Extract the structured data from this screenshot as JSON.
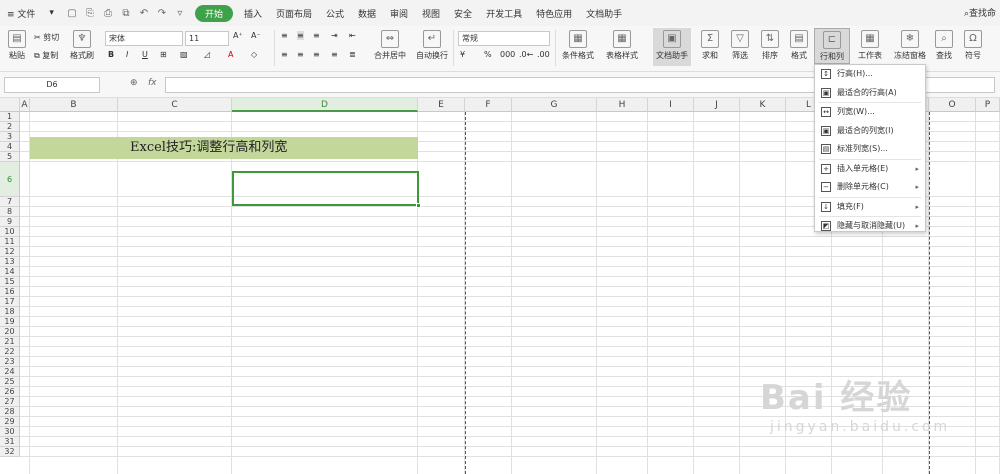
{
  "menubar": {
    "file": "≡ 文件",
    "tabs": [
      "开始",
      "插入",
      "页面布局",
      "公式",
      "数据",
      "审阅",
      "视图",
      "安全",
      "开发工具",
      "特色应用",
      "文档助手"
    ],
    "search": "查找命"
  },
  "ribbon": {
    "paste": "粘贴",
    "cut": "剪切",
    "copy": "复制",
    "format_painter": "格式刷",
    "font_name": "宋体",
    "font_size": "11",
    "merge": "合并居中",
    "wrap": "自动换行",
    "number_format": "常规",
    "cond_format": "条件格式",
    "table_style": "表格样式",
    "doc_helper": "文档助手",
    "sum": "求和",
    "filter": "筛选",
    "sort": "排序",
    "format": "格式",
    "row_col": "行和列",
    "worksheet": "工作表",
    "freeze": "冻结窗格",
    "find": "查找",
    "symbol": "符号"
  },
  "formula_bar": {
    "name_box": "D6",
    "fx": "fx",
    "content": ""
  },
  "sheet": {
    "columns": [
      "A",
      "B",
      "C",
      "D",
      "E",
      "F",
      "G",
      "H",
      "I",
      "J",
      "K",
      "L",
      "M",
      "N",
      "O",
      "P"
    ],
    "rows": [
      "1",
      "2",
      "3",
      "4",
      "5",
      "6",
      "7",
      "8",
      "9",
      "10",
      "11",
      "12",
      "13",
      "14",
      "15",
      "16",
      "17",
      "18",
      "19",
      "20",
      "21",
      "22",
      "23",
      "24",
      "25",
      "26",
      "27",
      "28",
      "29",
      "30",
      "31",
      "32"
    ],
    "title_cell": "Excel技巧:调整行高和列宽",
    "selected_cell": "D6",
    "title_fill": "#c4d79b",
    "accent": "#3fa14a"
  },
  "row_col_menu": {
    "items": [
      {
        "label": "行高(H)...",
        "icon": "row-height-icon",
        "submenu": false
      },
      {
        "label": "最适合的行高(A)",
        "icon": "autofit-row-icon",
        "submenu": false
      },
      {
        "label": "列宽(W)...",
        "icon": "col-width-icon",
        "submenu": false
      },
      {
        "label": "最适合的列宽(I)",
        "icon": "autofit-col-icon",
        "submenu": false
      },
      {
        "label": "标准列宽(S)...",
        "icon": "standard-width-icon",
        "submenu": false
      },
      {
        "label": "插入单元格(E)",
        "icon": "insert-cell-icon",
        "submenu": true
      },
      {
        "label": "删除单元格(C)",
        "icon": "delete-cell-icon",
        "submenu": true
      },
      {
        "label": "填充(F)",
        "icon": "fill-icon",
        "submenu": true
      },
      {
        "label": "隐藏与取消隐藏(U)",
        "icon": "hide-icon",
        "submenu": true
      }
    ]
  },
  "watermark": {
    "big": "Bai 经验",
    "small": "jingyan.baidu.com"
  }
}
